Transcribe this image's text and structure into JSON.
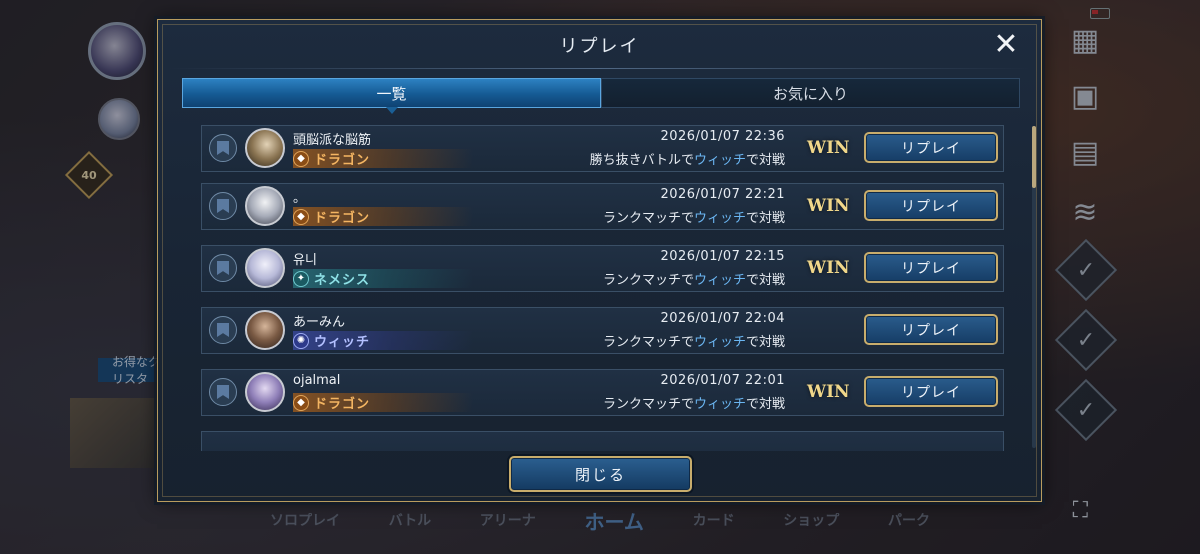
{
  "dialog": {
    "title": "リプレイ",
    "close_label": "閉じる"
  },
  "tabs": [
    {
      "label": "一覧",
      "active": true
    },
    {
      "label": "お気に入り",
      "active": false
    }
  ],
  "replays": [
    {
      "player": "頭脳派な脳筋",
      "class": "ドラゴン",
      "class_key": "dragon",
      "datetime": "2026/01/07 22:36",
      "desc_pre": "勝ち抜きバトルで",
      "desc_class": "ウィッチ",
      "desc_post": "で対戦",
      "result": "WIN",
      "button": "リプレイ"
    },
    {
      "player": "。",
      "class": "ドラゴン",
      "class_key": "dragon",
      "datetime": "2026/01/07 22:21",
      "desc_pre": "ランクマッチで",
      "desc_class": "ウィッチ",
      "desc_post": "で対戦",
      "result": "WIN",
      "button": "リプレイ"
    },
    {
      "player": "유니",
      "class": "ネメシス",
      "class_key": "nemesis",
      "datetime": "2026/01/07 22:15",
      "desc_pre": "ランクマッチで",
      "desc_class": "ウィッチ",
      "desc_post": "で対戦",
      "result": "WIN",
      "button": "リプレイ"
    },
    {
      "player": "あーみん",
      "class": "ウィッチ",
      "class_key": "witch",
      "datetime": "2026/01/07 22:04",
      "desc_pre": "ランクマッチで",
      "desc_class": "ウィッチ",
      "desc_post": "で対戦",
      "result": "",
      "button": "リプレイ"
    },
    {
      "player": "ojalmal",
      "class": "ドラゴン",
      "class_key": "dragon",
      "datetime": "2026/01/07 22:01",
      "desc_pre": "ランクマッチで",
      "desc_class": "ウィッチ",
      "desc_post": "で対戦",
      "result": "WIN",
      "button": "リプレイ"
    }
  ],
  "background": {
    "level": "40",
    "deal_label": "お得なクリスタ",
    "bottom_nav": [
      "ソロプレイ",
      "バトル",
      "アリーナ",
      "ホーム",
      "カード",
      "ショップ",
      "パーク"
    ]
  },
  "colors": {
    "accent_gold": "#c8ad6c",
    "tab_active": "#2d81c2",
    "highlight_text": "#6bb6f2",
    "win_text": "#f0d78a",
    "dragon": "#f4b562",
    "nemesis": "#8ee1e6",
    "witch": "#b3c0ff"
  },
  "icons": {
    "close": "close-icon",
    "favorite": "bookmark-star-icon",
    "menu": "grid-menu-icon",
    "gallery": "image-icon",
    "gift": "gift-icon",
    "scroll": "scroll-icon",
    "mission": "checkmark-icon",
    "fullscreen": "fullscreen-icon"
  }
}
